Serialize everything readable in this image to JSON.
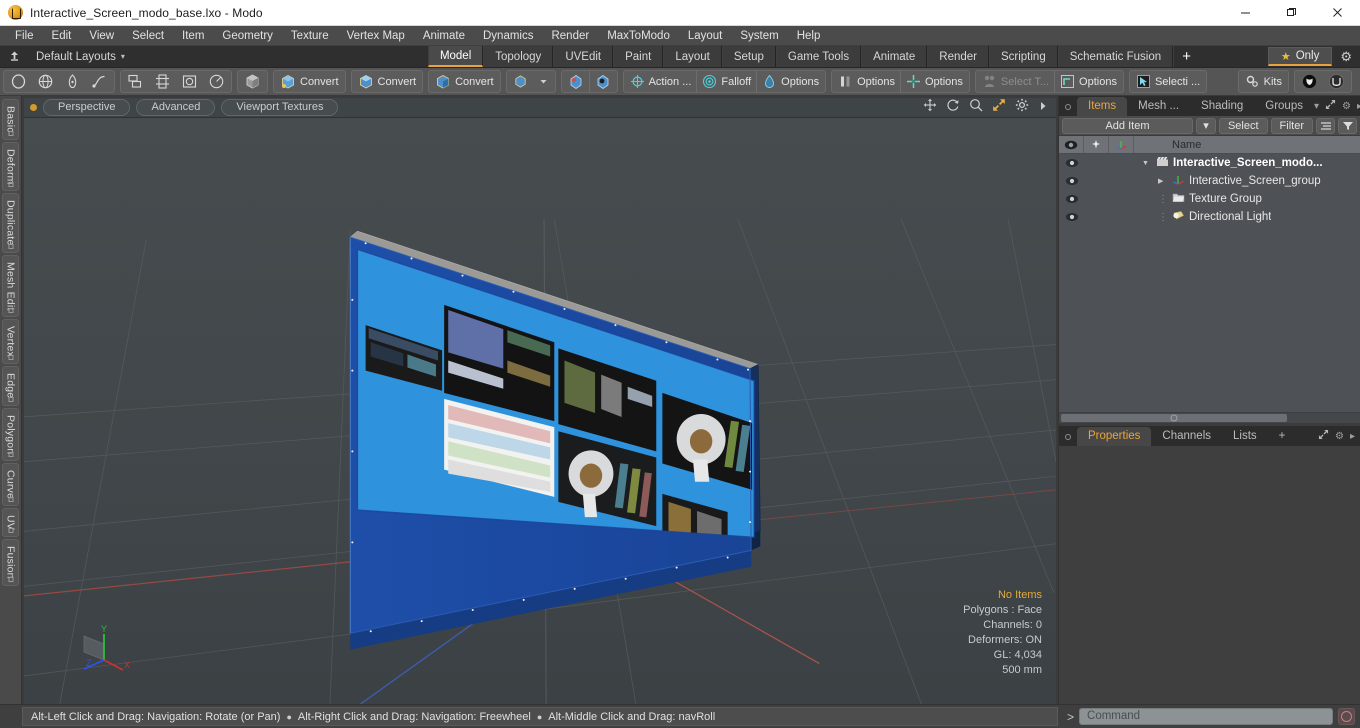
{
  "window": {
    "title": "Interactive_Screen_modo_base.lxo - Modo",
    "app_icon": "modo-logo-icon",
    "minimize": "—",
    "maximize": "❐",
    "close": "✕"
  },
  "menubar": {
    "items": [
      {
        "label": "File"
      },
      {
        "label": "Edit"
      },
      {
        "label": "View"
      },
      {
        "label": "Select"
      },
      {
        "label": "Item"
      },
      {
        "label": "Geometry"
      },
      {
        "label": "Texture"
      },
      {
        "label": "Vertex Map"
      },
      {
        "label": "Animate"
      },
      {
        "label": "Dynamics"
      },
      {
        "label": "Render"
      },
      {
        "label": "MaxToModo"
      },
      {
        "label": "Layout"
      },
      {
        "label": "System"
      },
      {
        "label": "Help"
      }
    ]
  },
  "layoutbar": {
    "home_icon": "home-anchor-icon",
    "layout_label": "Default Layouts",
    "caret": "▾",
    "tabs": [
      {
        "label": "Model",
        "active": true
      },
      {
        "label": "Topology",
        "active": false
      },
      {
        "label": "UVEdit",
        "active": false
      },
      {
        "label": "Paint",
        "active": false
      },
      {
        "label": "Layout",
        "active": false
      },
      {
        "label": "Setup",
        "active": false
      },
      {
        "label": "Game Tools",
        "active": false
      },
      {
        "label": "Animate",
        "active": false
      },
      {
        "label": "Render",
        "active": false
      },
      {
        "label": "Scripting",
        "active": false
      },
      {
        "label": "Schematic Fusion",
        "active": false
      }
    ],
    "add_tab": "+",
    "only_label": "Only",
    "star_icon": "star-icon",
    "gear_icon": "gear-icon"
  },
  "toolbar": {
    "groups": [
      {
        "buttons": [
          {
            "label": "",
            "icon": "ellipse-icon"
          },
          {
            "label": "",
            "icon": "sphere-icon"
          },
          {
            "label": "",
            "icon": "pen-icon"
          },
          {
            "label": "",
            "icon": "curve-icon"
          }
        ]
      },
      {
        "buttons": [
          {
            "label": "",
            "icon": "boolean-icon"
          },
          {
            "label": "",
            "icon": "axis-cube-icon"
          },
          {
            "label": "",
            "icon": "frame-icon"
          },
          {
            "label": "",
            "icon": "radial-icon"
          }
        ]
      },
      {
        "buttons": [
          {
            "label": "",
            "icon": "shaded-cube-icon"
          }
        ]
      },
      {
        "buttons": [
          {
            "label": "Convert",
            "icon": "convert-mesh-icon"
          }
        ]
      },
      {
        "buttons": [
          {
            "label": "Convert",
            "icon": "convert-cube-icon"
          }
        ]
      },
      {
        "buttons": [
          {
            "label": "Convert",
            "icon": "convert-poly-icon"
          }
        ]
      },
      {
        "buttons": [
          {
            "label": "",
            "icon": "cube-small-icon"
          },
          {
            "label": "",
            "icon": "chevron-down-icon"
          }
        ]
      },
      {
        "buttons": [
          {
            "label": "",
            "icon": "gem-red-icon"
          },
          {
            "label": "",
            "icon": "gem-dark-icon"
          }
        ]
      },
      {
        "buttons": [
          {
            "label": "Action  ...",
            "icon": "action-center-icon"
          },
          {
            "label": "Falloff",
            "icon": "falloff-icon"
          },
          {
            "label": "Options",
            "icon": "options-drop-icon"
          }
        ]
      },
      {
        "buttons": [
          {
            "label": "Options",
            "icon": "symmetry-icon"
          },
          {
            "label": "Options",
            "icon": "snap-icon"
          }
        ]
      },
      {
        "buttons": [
          {
            "label": "Select T...",
            "icon": "select-through-icon",
            "disabled": true
          },
          {
            "label": "Options",
            "icon": "workplane-icon"
          }
        ]
      },
      {
        "buttons": [
          {
            "label": "Selecti ...",
            "icon": "selection-arrow-icon"
          }
        ]
      },
      {
        "buttons": [
          {
            "label": "Kits",
            "icon": "kits-gear-icon"
          }
        ]
      },
      {
        "buttons": [
          {
            "label": "",
            "icon": "unreal-icon"
          },
          {
            "label": "",
            "icon": "unity-icon"
          }
        ]
      }
    ]
  },
  "left_rail": {
    "tabs": [
      {
        "label": "Basic"
      },
      {
        "label": "Deform"
      },
      {
        "label": "Duplicate"
      },
      {
        "label": "Mesh Edit"
      },
      {
        "label": "Vertex"
      },
      {
        "label": "Edge"
      },
      {
        "label": "Polygon"
      },
      {
        "label": "Curve"
      },
      {
        "label": "UV"
      },
      {
        "label": "Fusion"
      }
    ]
  },
  "viewport": {
    "header": {
      "indicator": "active-dot",
      "pills": [
        {
          "label": "Perspective"
        },
        {
          "label": "Advanced"
        },
        {
          "label": "Viewport Textures"
        }
      ],
      "tools": [
        {
          "icon": "move-icon"
        },
        {
          "icon": "rotate-icon"
        },
        {
          "icon": "zoom-icon"
        },
        {
          "icon": "fullscreen-icon"
        },
        {
          "icon": "gear-icon"
        },
        {
          "icon": "chevron-right-icon"
        }
      ]
    },
    "stats": {
      "selection": "No Items",
      "polygons": "Polygons : Face",
      "channels": "Channels: 0",
      "deformers": "Deformers: ON",
      "gl": "GL: 4,034",
      "scale": "500 mm"
    },
    "axis": {
      "x": "X",
      "y": "Y",
      "z": "Z"
    },
    "scene_description": "Blue interactive screen panel model with image thumbnails"
  },
  "right_panel": {
    "tabs": [
      {
        "label": "Items",
        "active": true
      },
      {
        "label": "Mesh ...",
        "active": false
      },
      {
        "label": "Shading",
        "active": false
      },
      {
        "label": "Groups",
        "active": false
      }
    ],
    "tab_tools": [
      "chevron-down-icon",
      "fullscreen-icon",
      "gear-icon",
      "chevron-right-icon"
    ],
    "items_toolbar": {
      "add_item": "Add Item",
      "add_caret": "▾",
      "select": "Select",
      "filter": "Filter",
      "list_icon": "list-view-icon",
      "funnel_icon": "funnel-icon"
    },
    "columns": {
      "eye": "eye-icon",
      "lock": "pin-icon",
      "axis": "axis-icon",
      "name": "Name"
    },
    "rows": [
      {
        "name": "Interactive_Screen_modo...",
        "icon": "scene-clapper-icon",
        "depth": 0,
        "expander": "▼",
        "bold": true,
        "eye": true
      },
      {
        "name": "Interactive_Screen_group",
        "icon": "group-axis-icon",
        "depth": 1,
        "expander": "▶",
        "bold": false,
        "eye": true
      },
      {
        "name": "Texture Group",
        "icon": "texture-folder-icon",
        "depth": 1,
        "expander": "",
        "bold": false,
        "eye": true
      },
      {
        "name": "Directional Light",
        "icon": "light-icon",
        "depth": 1,
        "expander": "",
        "bold": false,
        "eye": true
      }
    ],
    "properties_tabs": [
      {
        "label": "Properties",
        "active": true
      },
      {
        "label": "Channels",
        "active": false
      },
      {
        "label": "Lists",
        "active": false
      },
      {
        "label": "+",
        "active": false
      }
    ],
    "properties_tools": [
      "fullscreen-icon",
      "gear-icon",
      "chevron-right-icon"
    ]
  },
  "statusbar": {
    "hints": [
      "Alt-Left Click and Drag: Navigation: Rotate (or Pan)",
      "Alt-Right Click and Drag: Navigation: Freewheel",
      "Alt-Middle Click and Drag: navRoll"
    ],
    "bullet": "●",
    "command_prompt": ">",
    "command_placeholder": "Command",
    "record_icon": "record-icon"
  },
  "colors": {
    "accent_orange": "#e8a33d",
    "panel_bg": "#454545",
    "toolbar_bg": "#555555",
    "viewport_bg": "#41474a",
    "model_blue": "#1c4fa1",
    "model_light_blue": "#2f92dc"
  }
}
